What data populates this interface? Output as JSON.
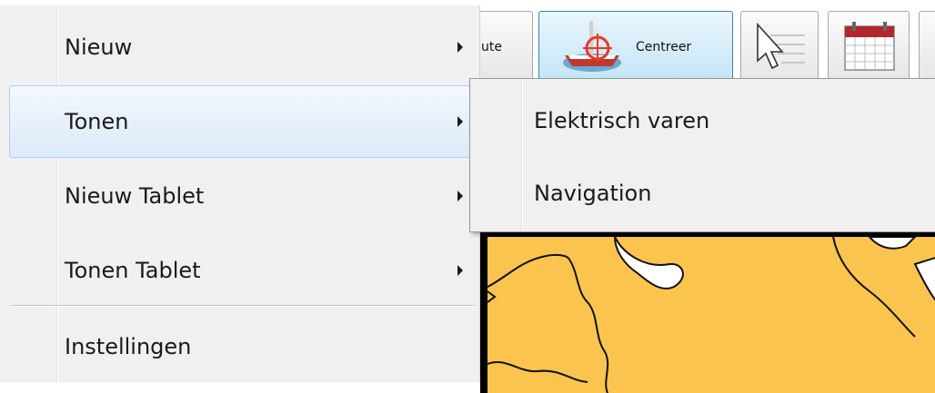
{
  "toolbar": {
    "route_partial_label": "ute",
    "centreer_label": "Centreer",
    "icons": [
      "centreer-icon",
      "select-cursor-icon",
      "calendar-icon"
    ]
  },
  "menu": {
    "items": [
      {
        "label": "Nieuw",
        "has_submenu": true,
        "highlighted": false
      },
      {
        "label": "Tonen",
        "has_submenu": true,
        "highlighted": true
      },
      {
        "label": "Nieuw Tablet",
        "has_submenu": true,
        "highlighted": false
      },
      {
        "label": "Tonen Tablet",
        "has_submenu": true,
        "highlighted": false
      },
      {
        "label": "Instellingen",
        "has_submenu": false,
        "highlighted": false
      }
    ]
  },
  "submenu": {
    "items": [
      {
        "label": "Elektrisch varen"
      },
      {
        "label": "Navigation"
      }
    ]
  },
  "colors": {
    "map_land": "#fbc44e",
    "menu_bg": "#f0f0f0",
    "highlight_border": "#aecff7"
  }
}
